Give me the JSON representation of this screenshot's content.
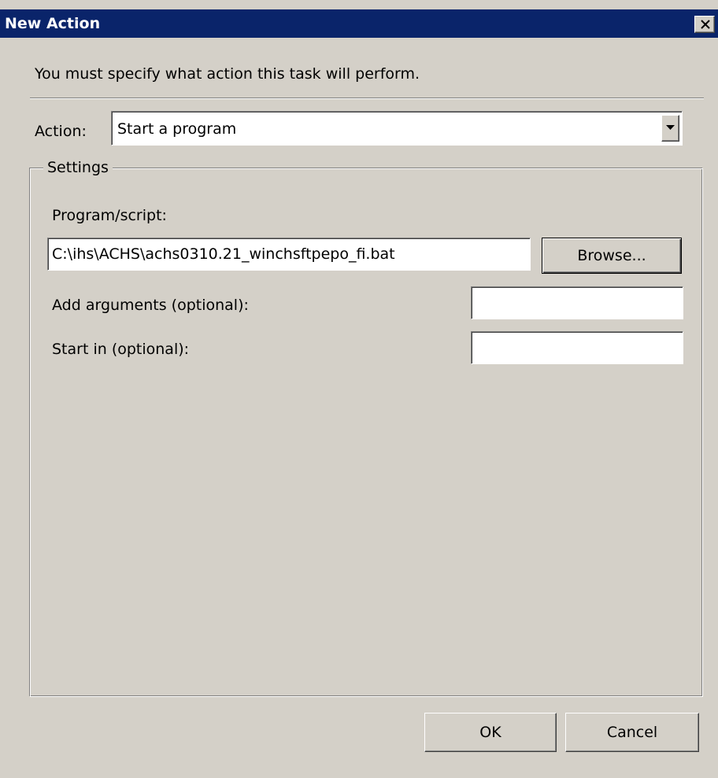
{
  "window": {
    "title": "New Action",
    "close_icon": "close-icon"
  },
  "instruction": "You must specify what action this task will perform.",
  "action": {
    "label": "Action:",
    "selected": "Start a program",
    "dropdown_icon": "chevron-down-icon"
  },
  "settings": {
    "legend": "Settings",
    "program_label": "Program/script:",
    "program_value": "C:\\ihs\\ACHS\\achs0310.21_winchsftpepo_fi.bat",
    "browse_label": "Browse...",
    "args_label": "Add arguments (optional):",
    "args_value": "",
    "startin_label": "Start in (optional):",
    "startin_value": ""
  },
  "buttons": {
    "ok_label": "OK",
    "cancel_label": "Cancel"
  },
  "colors": {
    "title_bar": "#0a246a",
    "dialog_face": "#d4d0c8"
  }
}
